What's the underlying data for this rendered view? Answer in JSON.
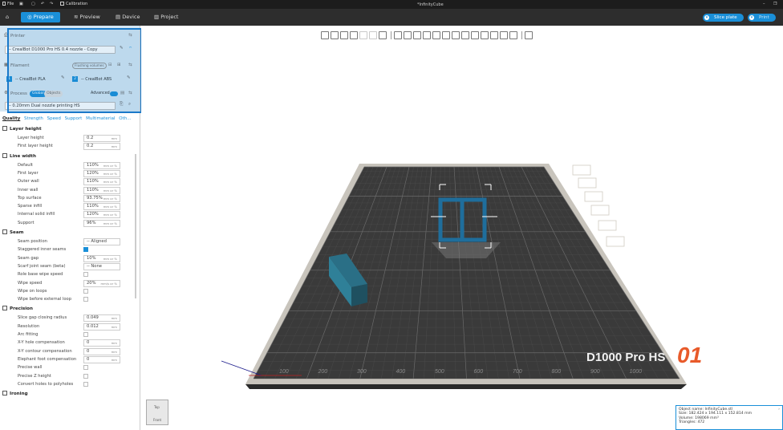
{
  "titlebar": {
    "file_label": "File",
    "calibration_label": "Calibration",
    "window_title": "*InfinityCube"
  },
  "tabs": {
    "prepare": "Prepare",
    "preview": "Preview",
    "device": "Device",
    "project": "Project"
  },
  "actions": {
    "slice_plate": "Slice plate",
    "print": "Print"
  },
  "printer": {
    "section_label": "Printer",
    "selected": "-- CrealBot D1000 Pro HS 0.4 nozzle - Copy"
  },
  "filament": {
    "section_label": "Filament",
    "flushing_button": "Flushing volumes",
    "slots": [
      {
        "index": "1",
        "name": "-- CrealBot PLA",
        "color": "#1a8fd8"
      },
      {
        "index": "2",
        "name": "-- CrealBot ABS",
        "color": "#1a8fd8"
      }
    ]
  },
  "process": {
    "section_label": "Process",
    "global_label": "Global",
    "objects_label": "Objects",
    "advanced_label": "Advanced",
    "selected": "-- 0.20mm Dual nozzle printing HS"
  },
  "settings_tabs": [
    "Quality",
    "Strength",
    "Speed",
    "Support",
    "Multimaterial",
    "Oth..."
  ],
  "sections": {
    "layer_height": {
      "title": "Layer height",
      "rows": [
        {
          "label": "Layer height",
          "value": "0.2",
          "unit": "mm"
        },
        {
          "label": "First layer height",
          "value": "0.2",
          "unit": "mm"
        }
      ]
    },
    "line_width": {
      "title": "Line width",
      "rows": [
        {
          "label": "Default",
          "value": "110%",
          "unit": "mm or %"
        },
        {
          "label": "First layer",
          "value": "120%",
          "unit": "mm or %"
        },
        {
          "label": "Outer wall",
          "value": "110%",
          "unit": "mm or %"
        },
        {
          "label": "Inner wall",
          "value": "110%",
          "unit": "mm or %"
        },
        {
          "label": "Top surface",
          "value": "93.75%",
          "unit": "mm or %"
        },
        {
          "label": "Sparse infill",
          "value": "110%",
          "unit": "mm or %"
        },
        {
          "label": "Internal solid infill",
          "value": "120%",
          "unit": "mm or %"
        },
        {
          "label": "Support",
          "value": "96%",
          "unit": "mm or %"
        }
      ]
    },
    "seam": {
      "title": "Seam",
      "rows": [
        {
          "label": "Seam position",
          "value": "-- Aligned",
          "unit": ""
        },
        {
          "label": "Staggered inner seams",
          "check": true
        },
        {
          "label": "Seam gap",
          "value": "10%",
          "unit": "mm or %"
        },
        {
          "label": "Scarf joint seam (beta)",
          "value": "-- None",
          "unit": ""
        },
        {
          "label": "Role base wipe speed",
          "check": false
        },
        {
          "label": "Wipe speed",
          "value": "20%",
          "unit": "mm/s or %"
        },
        {
          "label": "Wipe on loops",
          "check": false
        },
        {
          "label": "Wipe before external loop",
          "check": false
        }
      ]
    },
    "precision": {
      "title": "Precision",
      "rows": [
        {
          "label": "Slice gap closing radius",
          "value": "0.049",
          "unit": "mm"
        },
        {
          "label": "Resolution",
          "value": "0.012",
          "unit": "mm"
        },
        {
          "label": "Arc fitting",
          "check": false
        },
        {
          "label": "X-Y hole compensation",
          "value": "0",
          "unit": "mm"
        },
        {
          "label": "X-Y contour compensation",
          "value": "0",
          "unit": "mm"
        },
        {
          "label": "Elephant foot compensation",
          "value": "0",
          "unit": "mm"
        },
        {
          "label": "Precise wall",
          "check": false
        },
        {
          "label": "Precise Z height",
          "check": false
        },
        {
          "label": "Convert holes to polyholes",
          "check": false
        }
      ]
    },
    "ironing": {
      "title": "Ironing"
    }
  },
  "plate": {
    "brand_text": "D1000 Pro HS",
    "plate_number": "01",
    "axis_ticks": [
      "100",
      "200",
      "300",
      "400",
      "500",
      "600",
      "700",
      "800",
      "900",
      "1000"
    ]
  },
  "viewcube": {
    "top": "Top",
    "front": "Front"
  },
  "object_info": {
    "name": "Object name: InfinityCube.stl",
    "size": "Size: 182.424 x 194.111 x 152.814 mm",
    "volume": "Volume: 198069 mm³",
    "triangles": "Triangles: 472"
  },
  "colors": {
    "accent": "#1a8fd8",
    "plate_dark": "#3a3a3a",
    "plate_border": "#c8c4bc",
    "model": "#1f6e9c",
    "cube_object": "#2a6f86",
    "brand_orange": "#e85a2a"
  }
}
